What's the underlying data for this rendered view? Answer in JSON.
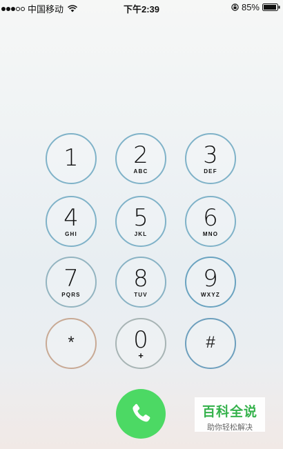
{
  "status_bar": {
    "carrier": "中国移动",
    "time": "下午2:39",
    "battery": "85%",
    "signal_bars_filled": 3,
    "signal_bars_total": 5
  },
  "keypad": {
    "keys": [
      {
        "digit": "1",
        "letters": ""
      },
      {
        "digit": "2",
        "letters": "ABC"
      },
      {
        "digit": "3",
        "letters": "DEF"
      },
      {
        "digit": "4",
        "letters": "GHI"
      },
      {
        "digit": "5",
        "letters": "JKL"
      },
      {
        "digit": "6",
        "letters": "MNO"
      },
      {
        "digit": "7",
        "letters": "PQRS"
      },
      {
        "digit": "8",
        "letters": "TUV"
      },
      {
        "digit": "9",
        "letters": "WXYZ"
      },
      {
        "digit": "*",
        "letters": ""
      },
      {
        "digit": "0",
        "letters": "+"
      },
      {
        "digit": "#",
        "letters": ""
      }
    ]
  },
  "call_button": {
    "icon": "phone-icon",
    "color": "#4cd964"
  },
  "watermark": {
    "title": "百科全说",
    "subtitle": "助你轻松解决"
  }
}
